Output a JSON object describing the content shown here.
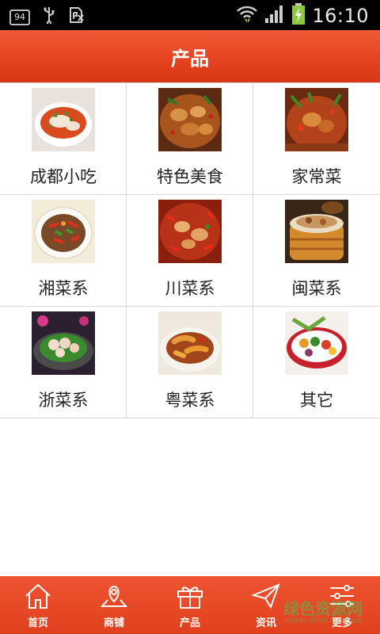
{
  "status_bar": {
    "notification_count": "94",
    "time": "16:10"
  },
  "header": {
    "title": "产品"
  },
  "categories": [
    {
      "label": "成都小吃",
      "icon": "food-photo-chengdu-snacks"
    },
    {
      "label": "特色美食",
      "icon": "food-photo-specialty"
    },
    {
      "label": "家常菜",
      "icon": "food-photo-home-cooking"
    },
    {
      "label": "湘菜系",
      "icon": "food-photo-hunan"
    },
    {
      "label": "川菜系",
      "icon": "food-photo-sichuan"
    },
    {
      "label": "闽菜系",
      "icon": "food-photo-fujian"
    },
    {
      "label": "浙菜系",
      "icon": "food-photo-zhejiang"
    },
    {
      "label": "粤菜系",
      "icon": "food-photo-cantonese"
    },
    {
      "label": "其它",
      "icon": "food-photo-other"
    }
  ],
  "bottom_nav": [
    {
      "label": "首页",
      "icon": "home-icon"
    },
    {
      "label": "商铺",
      "icon": "map-pin-icon"
    },
    {
      "label": "产品",
      "icon": "gift-icon"
    },
    {
      "label": "资讯",
      "icon": "paper-plane-icon"
    },
    {
      "label": "更多",
      "icon": "sliders-icon"
    }
  ],
  "watermark": {
    "text": "绿色资源网",
    "sub": "www.downcc.com"
  },
  "colors": {
    "accent": "#e5421f",
    "status_bar": "#000000"
  }
}
